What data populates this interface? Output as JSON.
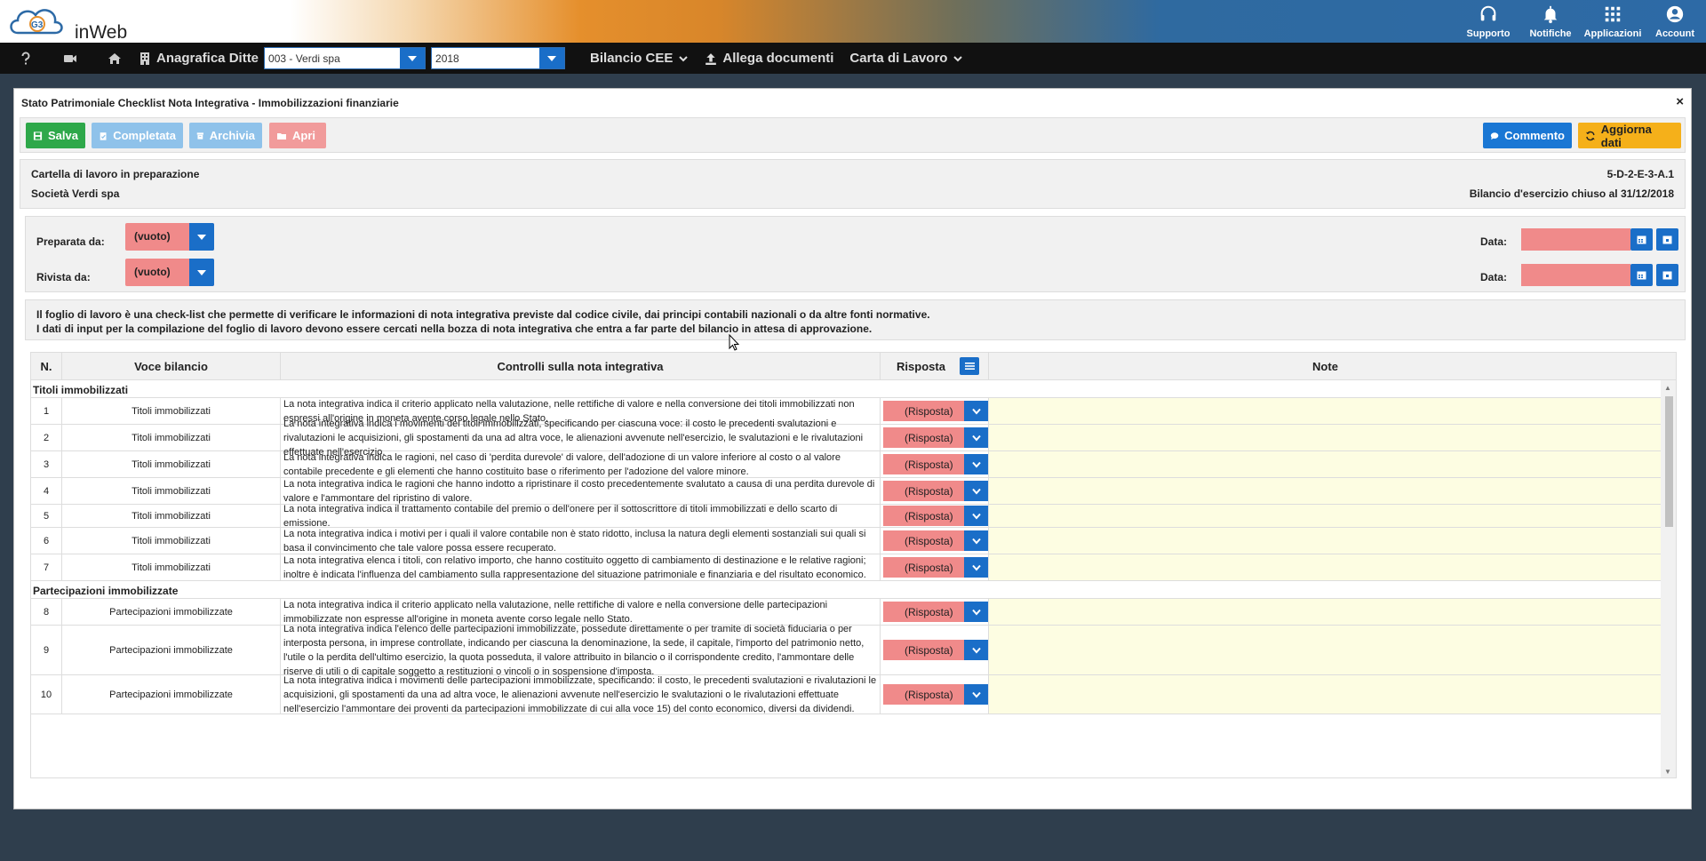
{
  "app": {
    "logo_text": "inWeb"
  },
  "top_actions": [
    {
      "label": "Supporto",
      "icon": "headset-icon"
    },
    {
      "label": "Notifiche",
      "icon": "bell-icon"
    },
    {
      "label": "Applicazioni",
      "icon": "apps-grid-icon"
    },
    {
      "label": "Account",
      "icon": "user-icon"
    }
  ],
  "navbar": {
    "anagrafica_label": "Anagrafica Ditte",
    "company_select": "003 - Verdi spa",
    "year_select": "2018",
    "bilancio_label": "Bilancio CEE",
    "allega_label": "Allega documenti",
    "carta_label": "Carta di Lavoro"
  },
  "modal": {
    "title": "Stato Patrimoniale Checklist Nota Integrativa - Immobilizzazioni finanziarie",
    "close": "×"
  },
  "toolbar": {
    "save": "Salva",
    "complete": "Completata",
    "archive": "Archivia",
    "open": "Apri",
    "comment": "Commento",
    "refresh": "Aggiorna dati"
  },
  "info": {
    "status": "Cartella di lavoro in preparazione",
    "company": "Società Verdi spa",
    "code": "5-D-2-E-3-A.1",
    "period": "Bilancio d'esercizio chiuso al 31/12/2018"
  },
  "prep": {
    "prepared_label": "Preparata da:",
    "prepared_value": "(vuoto)",
    "reviewed_label": "Rivista da:",
    "reviewed_value": "(vuoto)",
    "date_label": "Data:"
  },
  "description": {
    "line1": "Il foglio di lavoro è una check-list che permette di verificare le informazioni di nota integrativa previste dal codice civile, dai principi contabili nazionali o da altre fonti normative.",
    "line2": "I dati di input per la compilazione del foglio di lavoro devono essere cercati nella bozza di nota integrativa che entra a far parte del bilancio in attesa di approvazione."
  },
  "table": {
    "headers": {
      "n": "N.",
      "voce": "Voce bilancio",
      "controlli": "Controlli sulla nota integrativa",
      "risposta": "Risposta",
      "note": "Note"
    },
    "response_placeholder": "(Risposta)",
    "groups": [
      {
        "title": "Titoli immobilizzati",
        "rows": [
          {
            "n": "1",
            "voce": "Titoli immobilizzati",
            "text": "La nota integrativa indica il criterio applicato nella valutazione, nelle rettifiche di valore e nella conversione dei titoli immobilizzati non espressi all'origine in moneta avente corso legale nello Stato."
          },
          {
            "n": "2",
            "voce": "Titoli immobilizzati",
            "text": "La nota integrativa indica i movimenti dei titoli immobilizzati, specificando per ciascuna voce: il costo le precedenti svalutazioni e rivalutazioni le acquisizioni, gli spostamenti da una ad altra voce, le alienazioni avvenute nell'esercizio, le svalutazioni e le rivalutazioni effettuate nell'esercizio."
          },
          {
            "n": "3",
            "voce": "Titoli immobilizzati",
            "text": "La nota integrativa indica le ragioni, nel caso di 'perdita durevole' di valore, dell'adozione di un valore inferiore al costo o al valore contabile precedente e gli elementi che hanno costituito base o riferimento per l'adozione del valore minore."
          },
          {
            "n": "4",
            "voce": "Titoli immobilizzati",
            "text": "La nota integrativa indica le ragioni che hanno indotto a ripristinare il costo precedentemente svalutato a causa di una perdita durevole di valore e l'ammontare del ripristino di valore."
          },
          {
            "n": "5",
            "voce": "Titoli immobilizzati",
            "text": "La nota integrativa indica il trattamento contabile del premio o dell'onere per il sottoscrittore di titoli immobilizzati e dello scarto di emissione."
          },
          {
            "n": "6",
            "voce": "Titoli immobilizzati",
            "text": "La nota integrativa indica i motivi per i quali il valore contabile non è stato ridotto, inclusa la natura degli elementi sostanziali sui quali si basa il convincimento che tale valore possa essere recuperato."
          },
          {
            "n": "7",
            "voce": "Titoli immobilizzati",
            "text": "La nota integrativa elenca i titoli, con relativo importo, che hanno costituito oggetto di cambiamento di destinazione e le relative ragioni; inoltre è indicata l'influenza del cambiamento sulla rappresentazione del situazione patrimoniale e finanziaria e del risultato economico."
          }
        ]
      },
      {
        "title": "Partecipazioni immobilizzate",
        "rows": [
          {
            "n": "8",
            "voce": "Partecipazioni immobilizzate",
            "text": "La nota integrativa indica il criterio applicato nella valutazione, nelle rettifiche di valore e nella conversione delle partecipazioni immobilizzate non espresse all'origine in moneta avente corso legale nello Stato."
          },
          {
            "n": "9",
            "voce": "Partecipazioni immobilizzate",
            "text": "La nota integrativa indica l'elenco delle partecipazioni immobilizzate, possedute direttamente o per tramite di società fiduciaria o per interposta persona, in imprese controllate, indicando per ciascuna la denominazione, la sede, il capitale, l'importo del patrimonio netto, l'utile o la perdita dell'ultimo esercizio, la quota posseduta, il valore attribuito in bilancio o il corrispondente credito, l'ammontare delle riserve di utili o di capitale soggetto a restituzioni o vincoli o in sospensione d'imposta."
          },
          {
            "n": "10",
            "voce": "Partecipazioni immobilizzate",
            "text": "La nota integrativa indica i movimenti delle partecipazioni immobilizzate, specificando: il costo, le precedenti svalutazioni e rivalutazioni le acquisizioni, gli spostamenti da una ad altra voce, le alienazioni avvenute nell'esercizio le svalutazioni o le rivalutazioni effettuate nell'esercizio l'ammontare dei proventi da partecipazioni immobilizzate di cui alla voce 15) del conto economico, diversi da dividendi."
          }
        ]
      }
    ]
  }
}
